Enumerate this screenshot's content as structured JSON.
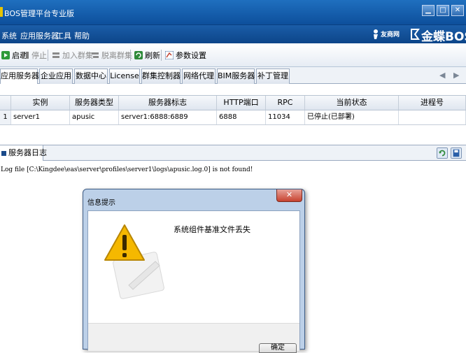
{
  "window": {
    "title": "BOS管理平台专业版",
    "minimize": "▁",
    "maximize": "□",
    "close": "✕"
  },
  "menu": {
    "items": [
      "系统",
      "应用服务器",
      "工具",
      "帮助"
    ],
    "brand_text": "金蝶BOS",
    "brand_logo_text": "友商网"
  },
  "toolbar": {
    "start": "启动",
    "stop": "停止",
    "join_cluster": "加入群集",
    "leave_cluster": "脱离群集",
    "refresh": "刷新",
    "params": "参数设置"
  },
  "tabs": [
    "应用服务器",
    "企业应用",
    "数据中心",
    "License",
    "群集控制器",
    "网络代理",
    "BIM服务器",
    "补丁管理"
  ],
  "grid": {
    "headers": [
      "实例",
      "服务器类型",
      "服务器标志",
      "HTTP端口",
      "RPC",
      "当前状态",
      "进程号"
    ],
    "rows": [
      {
        "num": "1",
        "instance": "server1",
        "type": "apusic",
        "flag": "server1:6888:6889",
        "http": "6888",
        "rpc": "11034",
        "status": "已停止(已部署)",
        "pid": ""
      }
    ]
  },
  "log": {
    "tab_label": "服务器日志",
    "line": "Log file [C:\\Kingdee\\eas\\server\\profiles\\server1\\logs\\apusic.log.0] is not found!"
  },
  "dialog": {
    "title": "信息提示",
    "message": "系统组件基准文件丢失",
    "ok": "确定",
    "close": "✕"
  },
  "colors": {
    "titlebar": "#1f6fbf",
    "menubar": "#1b5da8",
    "warning": "#f5b800"
  }
}
